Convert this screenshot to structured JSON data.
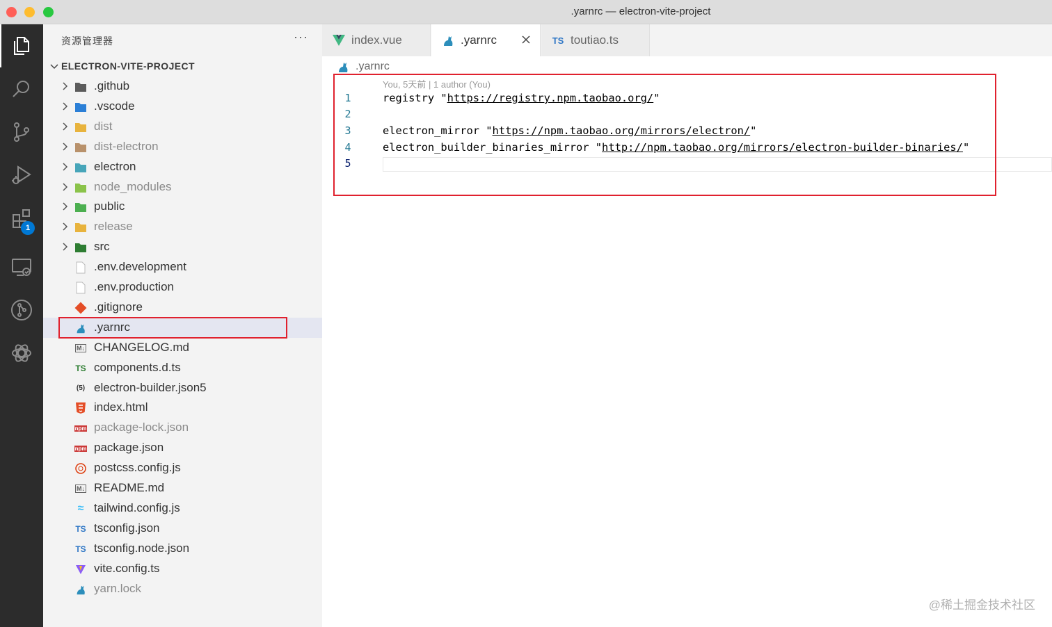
{
  "window": {
    "title": ".yarnrc — electron-vite-project"
  },
  "activity_bar": {
    "items": [
      {
        "name": "explorer-icon",
        "active": true
      },
      {
        "name": "search-icon"
      },
      {
        "name": "source-control-icon"
      },
      {
        "name": "run-debug-icon"
      },
      {
        "name": "extensions-icon",
        "badge": "1"
      },
      {
        "name": "remote-explorer-icon"
      },
      {
        "name": "git-graph-icon"
      },
      {
        "name": "chatgpt-icon"
      }
    ]
  },
  "sidebar": {
    "header": "资源管理器",
    "more": "···",
    "project": "ELECTRON-VITE-PROJECT",
    "items": [
      {
        "label": ".github",
        "type": "folder",
        "icon": "github-folder-icon",
        "color": "#5b5b5b"
      },
      {
        "label": ".vscode",
        "type": "folder",
        "icon": "vscode-folder-icon",
        "color": "#2b7fd6"
      },
      {
        "label": "dist",
        "type": "folder",
        "icon": "dist-folder-icon",
        "color": "#e8b33d",
        "dim": true
      },
      {
        "label": "dist-electron",
        "type": "folder",
        "icon": "folder-icon",
        "color": "#b8916b",
        "dim": true
      },
      {
        "label": "electron",
        "type": "folder",
        "icon": "electron-folder-icon",
        "color": "#47a5b9"
      },
      {
        "label": "node_modules",
        "type": "folder",
        "icon": "node-folder-icon",
        "color": "#8bc34a",
        "dim": true
      },
      {
        "label": "public",
        "type": "folder",
        "icon": "public-folder-icon",
        "color": "#4caf50"
      },
      {
        "label": "release",
        "type": "folder",
        "icon": "release-folder-icon",
        "color": "#e8b33d",
        "dim": true
      },
      {
        "label": "src",
        "type": "folder",
        "icon": "src-folder-icon",
        "color": "#2e7d32"
      },
      {
        "label": ".env.development",
        "type": "file",
        "icon": "file-icon",
        "color": "#bdbdbd"
      },
      {
        "label": ".env.production",
        "type": "file",
        "icon": "file-icon",
        "color": "#bdbdbd"
      },
      {
        "label": ".gitignore",
        "type": "file",
        "icon": "git-icon",
        "color": "#e44d26"
      },
      {
        "label": ".yarnrc",
        "type": "file",
        "icon": "yarn-icon",
        "color": "#2c8ebb",
        "selected": true
      },
      {
        "label": "CHANGELOG.md",
        "type": "file",
        "icon": "markdown-icon",
        "color": "#555555"
      },
      {
        "label": "components.d.ts",
        "type": "file",
        "icon": "typescript-def-icon",
        "color": "#2e7d32"
      },
      {
        "label": "electron-builder.json5",
        "type": "file",
        "icon": "json5-icon",
        "color": "#333333"
      },
      {
        "label": "index.html",
        "type": "file",
        "icon": "html-icon",
        "color": "#e44d26"
      },
      {
        "label": "package-lock.json",
        "type": "file",
        "icon": "npm-icon",
        "color": "#cb3837",
        "dim": true
      },
      {
        "label": "package.json",
        "type": "file",
        "icon": "npm-icon",
        "color": "#cb3837"
      },
      {
        "label": "postcss.config.js",
        "type": "file",
        "icon": "postcss-icon",
        "color": "#dd3a0a"
      },
      {
        "label": "README.md",
        "type": "file",
        "icon": "markdown-icon",
        "color": "#555555"
      },
      {
        "label": "tailwind.config.js",
        "type": "file",
        "icon": "tailwind-icon",
        "color": "#38bdf8"
      },
      {
        "label": "tsconfig.json",
        "type": "file",
        "icon": "tsconfig-icon",
        "color": "#3178c6"
      },
      {
        "label": "tsconfig.node.json",
        "type": "file",
        "icon": "tsconfig-icon",
        "color": "#3178c6"
      },
      {
        "label": "vite.config.ts",
        "type": "file",
        "icon": "vite-icon",
        "color": "#8b5cf6"
      },
      {
        "label": "yarn.lock",
        "type": "file",
        "icon": "yarn-icon",
        "color": "#2c8ebb",
        "dim": true
      }
    ]
  },
  "tabs": [
    {
      "label": "index.vue",
      "icon": "vue-icon",
      "icon_glyph": "V",
      "color": "#41b883"
    },
    {
      "label": ".yarnrc",
      "icon": "yarn-icon",
      "icon_glyph": "",
      "color": "#2c8ebb",
      "active": true
    },
    {
      "label": "toutiao.ts",
      "icon": "typescript-icon",
      "icon_glyph": "TS",
      "color": "#3178c6"
    }
  ],
  "breadcrumb": {
    "file": ".yarnrc"
  },
  "editor": {
    "blame": "You, 5天前 | 1 author (You)",
    "lines": [
      {
        "n": "1",
        "key": "registry \"",
        "url": "https://registry.npm.taobao.org/",
        "tail": "\""
      },
      {
        "n": "2",
        "key": "",
        "url": "",
        "tail": ""
      },
      {
        "n": "3",
        "key": "electron_mirror \"",
        "url": "https://npm.taobao.org/mirrors/electron/",
        "tail": "\""
      },
      {
        "n": "4",
        "key": "electron_builder_binaries_mirror \"",
        "url": "http://npm.taobao.org/mirrors/electron-builder-binaries/",
        "tail": "\""
      },
      {
        "n": "5",
        "key": "",
        "url": "",
        "tail": "",
        "current": true
      }
    ]
  },
  "watermark": "@稀土掘金技术社区",
  "colors": {
    "highlight_box": "#e0212e",
    "selection": "#e4e6f1",
    "activity_bar": "#2c2c2c",
    "line_number": "#237893"
  }
}
